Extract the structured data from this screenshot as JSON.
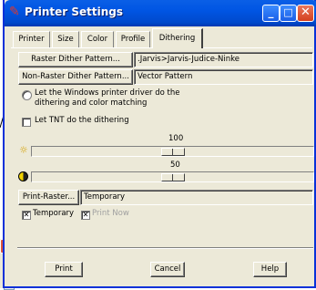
{
  "window": {
    "title": "Printer Settings",
    "controls": {
      "minimize": "_",
      "maximize": "□",
      "close": "✕"
    }
  },
  "tabs": [
    {
      "label": "Printer"
    },
    {
      "label": "Size"
    },
    {
      "label": "Color"
    },
    {
      "label": "Profile"
    },
    {
      "label": "Dithering",
      "selected": true
    }
  ],
  "dithering": {
    "raster_button": "Raster Dither Pattern...",
    "raster_value": ".Jarvis>Jarvis-Judice-Ninke",
    "nonraster_button": "Non-Raster Dither Pattern...",
    "nonraster_value": "Vector Pattern",
    "option_windows": "Let the Windows printer driver do the dithering and color matching",
    "option_tnt": "Let TNT do the dithering",
    "brightness_value": "100",
    "brightness_position": 0.5,
    "contrast_value": "50",
    "contrast_position": 0.5,
    "print_raster_button": "Print-Raster...",
    "print_raster_value": "Temporary",
    "temporary_label": "Temporary",
    "temporary_checked": true,
    "print_now_label": "Print Now",
    "print_now_checked": true
  },
  "footer": {
    "print": "Print",
    "cancel": "Cancel",
    "help": "Help"
  },
  "background_window": {
    "close": "✕"
  }
}
